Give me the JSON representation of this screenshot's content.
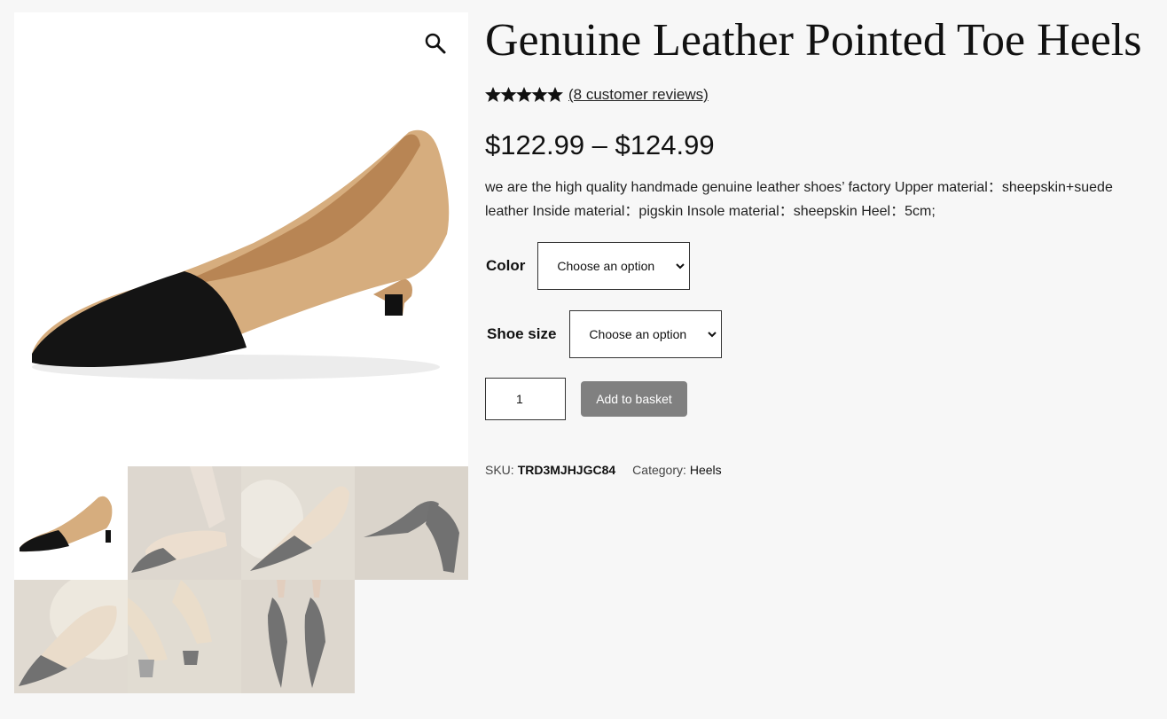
{
  "product": {
    "title": "Genuine Leather Pointed Toe Heels",
    "rating": 5,
    "rating_max": 5,
    "reviews_link": "(8 customer reviews)",
    "price": "$122.99 – $124.99",
    "description": "we are the high quality handmade genuine leather shoes’ factory Upper material：sheepskin+suede leather Inside material：pigskin Insole material：sheepskin Heel：5cm;"
  },
  "variations": {
    "color_label": "Color",
    "color_value": "Choose an option",
    "size_label": "Shoe size",
    "size_value": "Choose an option"
  },
  "cart": {
    "quantity": "1",
    "add_label": "Add to basket"
  },
  "meta": {
    "sku_label": "SKU:",
    "sku_value": "TRD3MJHJGC84",
    "category_label": "Category:",
    "category_value": "Heels"
  },
  "gallery": {
    "thumb_count": 7,
    "icons": {
      "zoom": "magnifier-icon",
      "select": "chevron-down-icon",
      "star": "star-icon"
    },
    "colors": {
      "tan": "#d3a97a",
      "black": "#111111",
      "background": "#f7f7f7",
      "button": "#808080"
    }
  }
}
